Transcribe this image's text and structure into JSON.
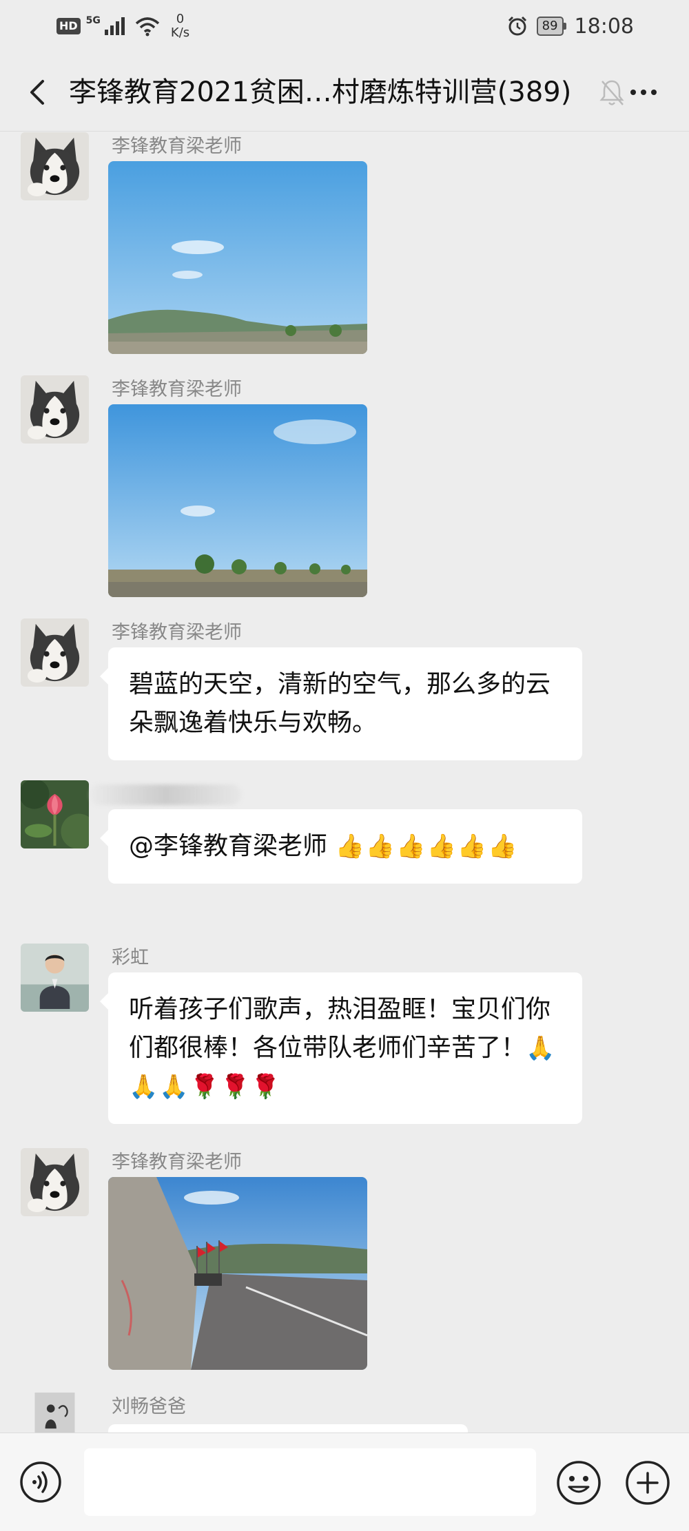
{
  "status_bar": {
    "hd": "HD",
    "network": "5G",
    "speed_value": "0",
    "speed_unit": "K/s",
    "battery": "89",
    "time": "18:08"
  },
  "header": {
    "title": "李锋教育2021贫困…村磨炼特训营(389)"
  },
  "messages": [
    {
      "sender": "李锋教育梁老师",
      "type": "image",
      "image": "sky-landscape"
    },
    {
      "sender": "李锋教育梁老师",
      "type": "image",
      "image": "sky-trees"
    },
    {
      "sender": "李锋教育梁老师",
      "type": "text",
      "text": "碧蓝的天空，清新的空气，那么多的云朵飘逸着快乐与欢畅。"
    },
    {
      "sender": "",
      "type": "text",
      "text": "@李锋教育梁老师 ",
      "emoji": "👍👍👍👍👍👍"
    },
    {
      "sender": "彩虹",
      "type": "text",
      "text": "听着孩子们歌声，热泪盈眶！宝贝们你们都很棒！各位带队老师们辛苦了！",
      "emoji": "🙏🙏🙏🌹🌹🌹"
    },
    {
      "sender": "李锋教育梁老师",
      "type": "image",
      "image": "road-march-flags"
    },
    {
      "sender": "刘畅爸爸",
      "type": "text",
      "text": ""
    }
  ],
  "bottom_bar": {
    "input_placeholder": ""
  },
  "colors": {
    "background": "#ededed",
    "bubble": "#ffffff",
    "sender_name": "#888888"
  }
}
